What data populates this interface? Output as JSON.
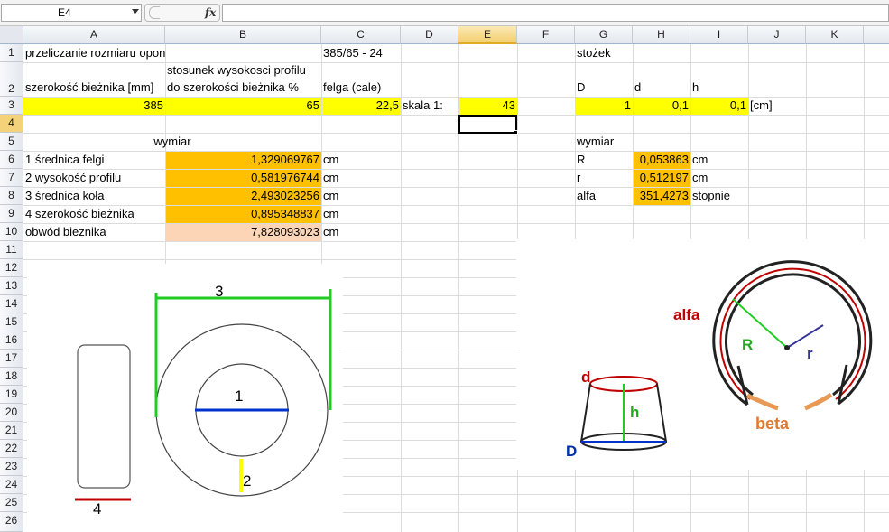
{
  "formula_bar": {
    "name_box": "E4",
    "fx_label": "fx",
    "formula": ""
  },
  "columns": [
    "A",
    "B",
    "C",
    "D",
    "E",
    "F",
    "G",
    "H",
    "I",
    "J",
    "K"
  ],
  "rows": [
    "1",
    "2",
    "3",
    "4",
    "5",
    "6",
    "7",
    "8",
    "9",
    "10",
    "11",
    "12",
    "13",
    "14",
    "15",
    "16",
    "17",
    "18",
    "19",
    "20",
    "21",
    "22",
    "23",
    "24",
    "25",
    "26"
  ],
  "cells": {
    "A1": "przeliczanie rozmiaru opon",
    "C1": "385/65 - 24",
    "G1": "stożek",
    "B2a": "stosunek wysokosci profilu",
    "A2": "szerokość bieżnika [mm]",
    "B2": "do szerokości bieżnika %",
    "C2": "felga (cale)",
    "G2": "D",
    "H2": "d",
    "I2": "h",
    "A3": "385",
    "B3": "65",
    "C3": "22,5",
    "D3": "skala 1:",
    "E3": "43",
    "G3": "1",
    "H3": "0,1",
    "I3": "0,1",
    "J3": "[cm]",
    "B5": "wymiar",
    "G5": "wymiar",
    "A6": "1 średnica felgi",
    "B6": "1,329069767",
    "C6": "cm",
    "G6": "R",
    "H6": "0,053863",
    "I6": "cm",
    "A7": "2 wysokość profilu",
    "B7": "0,581976744",
    "C7": "cm",
    "G7": "r",
    "H7": "0,512197",
    "I7": "cm",
    "A8": "3 średnica koła",
    "B8": "2,493023256",
    "C8": "cm",
    "G8": "alfa",
    "H8": "351,4273",
    "I8": "stopnie",
    "A9": "4 szerokość bieżnika",
    "B9": "0,895348837",
    "C9": "cm",
    "A10": "obwód bieznika",
    "B10": "7,828093023",
    "C10": "cm"
  },
  "tire_diagram": {
    "label_1": "1",
    "label_2": "2",
    "label_3": "3",
    "label_4": "4"
  },
  "cone_diagram": {
    "label_d": "d",
    "label_h": "h",
    "label_D": "D",
    "label_alfa": "alfa",
    "label_R": "R",
    "label_r": "r",
    "label_beta": "beta"
  },
  "colors": {
    "yellow": "#ffff00",
    "orange": "#ffc000",
    "peach": "#fbd5b5",
    "selected_header": "#f4d27a"
  }
}
